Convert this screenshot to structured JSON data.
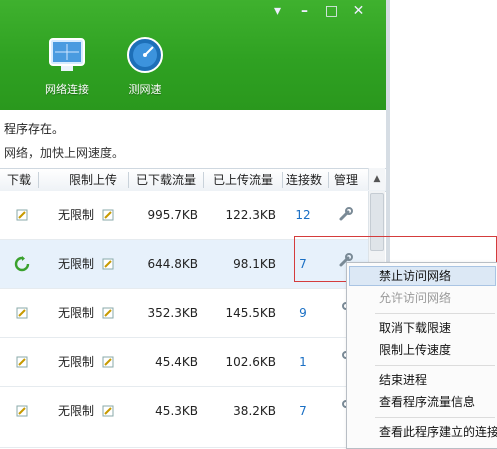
{
  "window": {
    "controls": [
      "▾",
      "–",
      "□",
      "✕"
    ]
  },
  "toolbar": {
    "network_label": "网络连接",
    "speed_label": "测网速"
  },
  "info": {
    "line1": "程序存在。",
    "line2": "网络，加快上网速度。"
  },
  "table": {
    "headers": [
      "下载",
      "限制上传",
      "已下载流量",
      "已上传流量",
      "连接数",
      "管理"
    ],
    "rows": [
      {
        "upload_limit": "无限制",
        "downloaded": "995.7KB",
        "uploaded": "122.3KB",
        "connections": "12",
        "status_icon": ""
      },
      {
        "upload_limit": "无限制",
        "downloaded": "644.8KB",
        "uploaded": "98.1KB",
        "connections": "7",
        "status_icon": "refresh-icon"
      },
      {
        "upload_limit": "无限制",
        "downloaded": "352.3KB",
        "uploaded": "145.5KB",
        "connections": "9",
        "status_icon": ""
      },
      {
        "upload_limit": "无限制",
        "downloaded": "45.4KB",
        "uploaded": "102.6KB",
        "connections": "1",
        "status_icon": ""
      },
      {
        "upload_limit": "无限制",
        "downloaded": "45.3KB",
        "uploaded": "38.2KB",
        "connections": "7",
        "status_icon": ""
      }
    ]
  },
  "menu": {
    "items": [
      {
        "label": "禁止访问网络",
        "disabled": false
      },
      {
        "label": "允许访问网络",
        "disabled": true
      },
      {
        "label": "取消下载限速",
        "disabled": false
      },
      {
        "label": "限制上传速度",
        "disabled": false
      },
      {
        "label": "结束进程",
        "disabled": false
      },
      {
        "label": "查看程序流量信息",
        "disabled": false
      },
      {
        "label": "查看此程序建立的连接",
        "disabled": false
      }
    ]
  },
  "colors": {
    "toolbar_green": "#2fa122",
    "link_blue": "#1a6fc4",
    "highlight_red": "#d43c3c"
  }
}
